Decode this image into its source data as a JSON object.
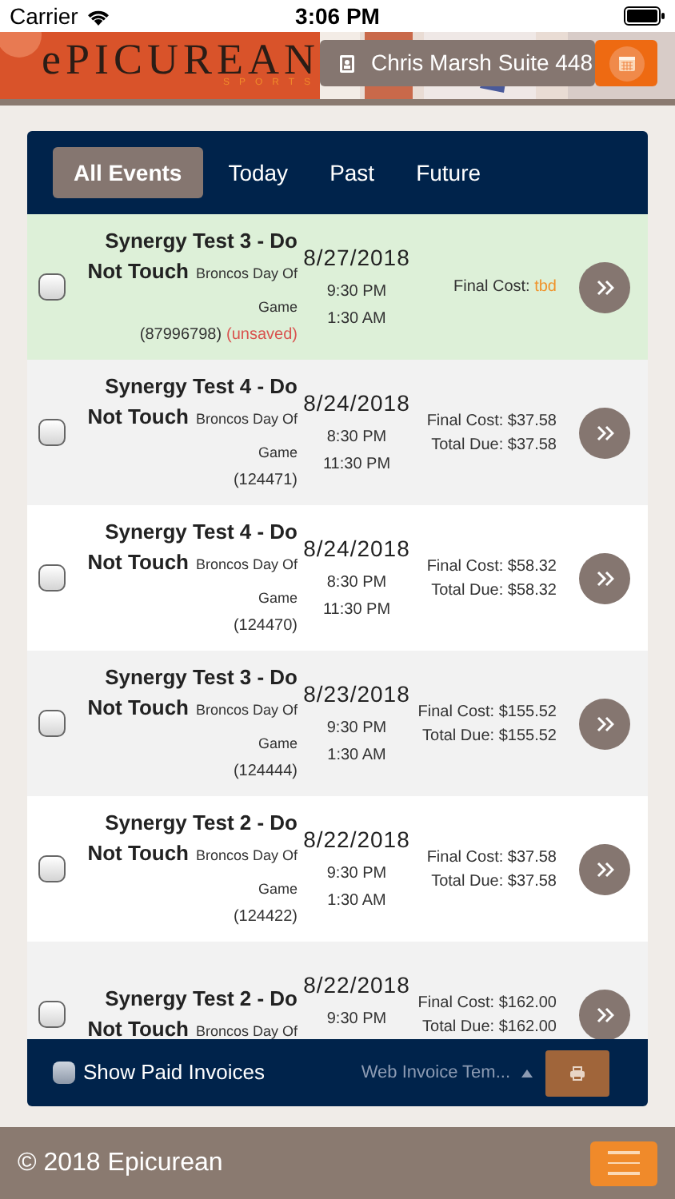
{
  "status_bar": {
    "carrier": "Carrier",
    "time": "3:06 PM"
  },
  "header": {
    "logo": "ePICUREAN",
    "logo_sub": "SPORTS",
    "suite_button": "Chris Marsh Suite 448"
  },
  "tabs": [
    {
      "label": "All Events",
      "selected": true
    },
    {
      "label": "Today",
      "selected": false
    },
    {
      "label": "Past",
      "selected": false
    },
    {
      "label": "Future",
      "selected": false
    }
  ],
  "events": [
    {
      "title": "Synergy Test 3 - Do Not Touch",
      "venue": "Broncos Day Of Game",
      "id": "(87996798)",
      "note": "(unsaved)",
      "date": "8/27/2018",
      "start": "9:30 PM",
      "end": "1:30 AM",
      "highlighted": true,
      "checked": false,
      "costs": [
        {
          "label": "Final Cost:",
          "value": "tbd",
          "pending": true
        }
      ]
    },
    {
      "title": "Synergy Test 4 - Do Not Touch",
      "venue": "Broncos Day Of Game",
      "id": "(124471)",
      "date": "8/24/2018",
      "start": "8:30 PM",
      "end": "11:30 PM",
      "highlighted": false,
      "checked": false,
      "costs": [
        {
          "label": "Final Cost:",
          "value": "$37.58",
          "pending": false
        },
        {
          "label": "Total Due:",
          "value": "$37.58",
          "pending": false
        }
      ]
    },
    {
      "title": "Synergy Test 4 - Do Not Touch",
      "venue": "Broncos Day Of Game",
      "id": "(124470)",
      "date": "8/24/2018",
      "start": "8:30 PM",
      "end": "11:30 PM",
      "highlighted": false,
      "checked": false,
      "costs": [
        {
          "label": "Final Cost:",
          "value": "$58.32",
          "pending": false
        },
        {
          "label": "Total Due:",
          "value": "$58.32",
          "pending": false
        }
      ]
    },
    {
      "title": "Synergy Test 3 - Do Not Touch",
      "venue": "Broncos Day Of Game",
      "id": "(124444)",
      "date": "8/23/2018",
      "start": "9:30 PM",
      "end": "1:30 AM",
      "highlighted": false,
      "checked": false,
      "costs": [
        {
          "label": "Final Cost:",
          "value": "$155.52",
          "pending": false
        },
        {
          "label": "Total Due:",
          "value": "$155.52",
          "pending": false
        }
      ]
    },
    {
      "title": "Synergy Test 2 - Do Not Touch",
      "venue": "Broncos Day Of Game",
      "id": "(124422)",
      "date": "8/22/2018",
      "start": "9:30 PM",
      "end": "1:30 AM",
      "highlighted": false,
      "checked": false,
      "costs": [
        {
          "label": "Final Cost:",
          "value": "$37.58",
          "pending": false
        },
        {
          "label": "Total Due:",
          "value": "$37.58",
          "pending": false
        }
      ]
    },
    {
      "title": "Synergy Test 2 - Do Not Touch",
      "venue": "Broncos Day Of",
      "date": "8/22/2018",
      "start": "9:30 PM",
      "highlighted": false,
      "checked": false,
      "costs": [
        {
          "label": "Final Cost:",
          "value": "$162.00",
          "pending": false
        },
        {
          "label": "Total Due:",
          "value": "$162.00",
          "pending": false
        }
      ]
    }
  ],
  "list_footer": {
    "show_paid": {
      "label": "Show Paid Invoices",
      "checked": false
    },
    "template_select": "Web Invoice Tem..."
  },
  "footer": {
    "copyright": "© 2018 Epicurean"
  }
}
